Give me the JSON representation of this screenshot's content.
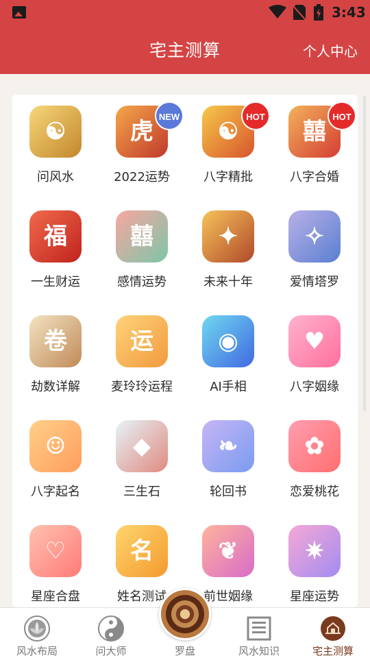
{
  "status": {
    "time": "3:43"
  },
  "header": {
    "title": "宅主测算",
    "right_link": "个人中心"
  },
  "items": [
    {
      "label": "问风水",
      "badge": "",
      "glyph": "☯",
      "bg": [
        "#f7d77a",
        "#c3862c"
      ]
    },
    {
      "label": "2022运势",
      "badge": "NEW",
      "glyph": "虎",
      "bg": [
        "#f4a74a",
        "#c0392b"
      ]
    },
    {
      "label": "八字精批",
      "badge": "HOT",
      "glyph": "☯",
      "bg": [
        "#f6c94a",
        "#d8542c"
      ]
    },
    {
      "label": "八字合婚",
      "badge": "HOT",
      "glyph": "囍",
      "bg": [
        "#f2b25b",
        "#d43d33"
      ]
    },
    {
      "label": "一生财运",
      "badge": "",
      "glyph": "福",
      "bg": [
        "#f06a4c",
        "#c0231e"
      ]
    },
    {
      "label": "感情运势",
      "badge": "",
      "glyph": "囍",
      "bg": [
        "#f9a6a0",
        "#7cc6a8"
      ]
    },
    {
      "label": "未来十年",
      "badge": "",
      "glyph": "✦",
      "bg": [
        "#f7c35a",
        "#b0492a"
      ]
    },
    {
      "label": "爱情塔罗",
      "badge": "",
      "glyph": "✧",
      "bg": [
        "#b9b0e8",
        "#5a7fd0"
      ]
    },
    {
      "label": "劫数详解",
      "badge": "",
      "glyph": "卷",
      "bg": [
        "#f3e3c2",
        "#c08a57"
      ]
    },
    {
      "label": "麦玲玲运程",
      "badge": "",
      "glyph": "运",
      "bg": [
        "#ffd27a",
        "#f19a3e"
      ]
    },
    {
      "label": "AI手相",
      "badge": "",
      "glyph": "◉",
      "bg": [
        "#6fd8f0",
        "#4169e1"
      ]
    },
    {
      "label": "八字姻缘",
      "badge": "",
      "glyph": "♥",
      "bg": [
        "#ffb3cf",
        "#ff6f9c"
      ]
    },
    {
      "label": "八字起名",
      "badge": "",
      "glyph": "☺",
      "bg": [
        "#ffd08a",
        "#ff9d5c"
      ]
    },
    {
      "label": "三生石",
      "badge": "",
      "glyph": "◆",
      "bg": [
        "#e6f3f8",
        "#e08a80"
      ]
    },
    {
      "label": "轮回书",
      "badge": "",
      "glyph": "❧",
      "bg": [
        "#c6b5f5",
        "#7b9cf0"
      ]
    },
    {
      "label": "恋爱桃花",
      "badge": "",
      "glyph": "✿",
      "bg": [
        "#ff9db0",
        "#ff6f6f"
      ]
    },
    {
      "label": "星座合盘",
      "badge": "",
      "glyph": "♡",
      "bg": [
        "#ffc2b0",
        "#ff7a78"
      ]
    },
    {
      "label": "姓名测试",
      "badge": "",
      "glyph": "名",
      "bg": [
        "#ffd56e",
        "#f39a2e"
      ]
    },
    {
      "label": "前世姻缘",
      "badge": "",
      "glyph": "❦",
      "bg": [
        "#ffb39c",
        "#d86cc8"
      ]
    },
    {
      "label": "星座运势",
      "badge": "",
      "glyph": "✷",
      "bg": [
        "#f6a8d6",
        "#a38cf0"
      ]
    }
  ],
  "tabs": [
    {
      "label": "风水布局",
      "icon": "lotus-icon",
      "active": false
    },
    {
      "label": "问大师",
      "icon": "yin-yang-icon",
      "active": false
    },
    {
      "label": "罗盘",
      "icon": "compass-icon",
      "active": false
    },
    {
      "label": "风水知识",
      "icon": "book-icon",
      "active": false
    },
    {
      "label": "宅主测算",
      "icon": "house-icon",
      "active": true
    }
  ],
  "colors": {
    "brand": "#d44444",
    "active_tab": "#7a3a1e"
  }
}
